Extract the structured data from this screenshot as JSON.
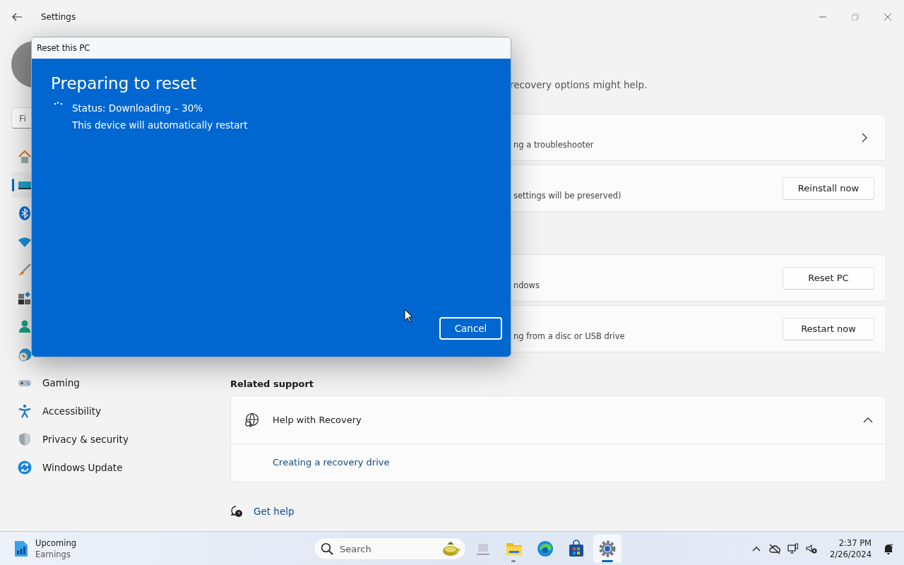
{
  "window": {
    "title": "Settings"
  },
  "search": {
    "placeholder": "Fi"
  },
  "sidebar": {
    "items": [
      {
        "selected": false
      },
      {
        "selected": true
      },
      {
        "selected": false
      },
      {
        "selected": false
      },
      {
        "selected": false
      },
      {
        "selected": false
      },
      {
        "selected": false
      },
      {
        "selected": false
      },
      {
        "label": "Gaming",
        "selected": false
      },
      {
        "label": "Accessibility",
        "selected": false
      },
      {
        "label": "Privacy & security",
        "selected": false
      },
      {
        "label": "Windows Update",
        "selected": false
      }
    ]
  },
  "intro": "recovery options might help.",
  "option_groups": [
    [
      {
        "kind": "link",
        "description": "ng a troubleshooter"
      },
      {
        "kind": "button",
        "description": "settings will be preserved)",
        "button": "Reinstall now"
      }
    ],
    [
      {
        "kind": "button",
        "description": "ndows",
        "button": "Reset PC"
      },
      {
        "kind": "button",
        "description": "ng from a disc or USB drive",
        "button": "Restart now"
      }
    ]
  ],
  "related_support": {
    "heading": "Related support",
    "title": "Help with Recovery",
    "expanded": true,
    "links": [
      "Creating a recovery drive"
    ]
  },
  "get_help": "Get help",
  "dialog": {
    "title": "Reset this PC",
    "heading": "Preparing to reset",
    "status": "Status: Downloading – 30%",
    "note": "This device will automatically restart",
    "cancel": "Cancel"
  },
  "taskbar": {
    "widget": {
      "title": "Upcoming",
      "subtitle": "Earnings"
    },
    "search": {
      "placeholder": "Search"
    },
    "apps": [
      {
        "selected": false,
        "running": false
      },
      {
        "selected": false,
        "running": true
      },
      {
        "selected": false,
        "running": false
      },
      {
        "selected": false,
        "running": false
      },
      {
        "selected": true,
        "running": true
      }
    ],
    "clock": {
      "time": "2:37 PM",
      "date": "2/26/2024"
    }
  }
}
